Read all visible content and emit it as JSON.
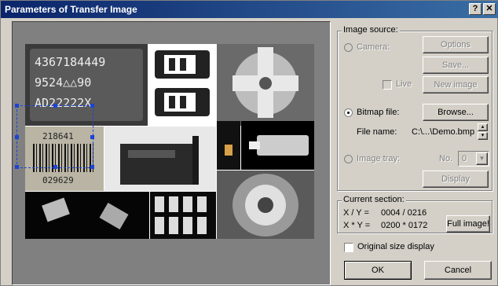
{
  "window": {
    "title": "Parameters of Transfer Image",
    "help_label": "?",
    "close_label": "✕"
  },
  "preview": {
    "barcode_top": "218641",
    "barcode_bottom": "029629",
    "chip_line1": "4367184449",
    "chip_line2": "9524△△90",
    "chip_line3": "AD22222X"
  },
  "image_source": {
    "legend": "Image source:",
    "camera_label": "Camera:",
    "options_label": "Options",
    "save_label": "Save...",
    "live_label": "Live",
    "new_image_label": "New image",
    "bitmap_label": "Bitmap file:",
    "browse_label": "Browse...",
    "file_name_label": "File name:",
    "file_name_value": "C:\\...\\Demo.bmp",
    "image_tray_label": "Image tray:",
    "no_label": "No.",
    "no_value": "0",
    "display_label": "Display",
    "selected": "bitmap"
  },
  "current_section": {
    "legend": "Current section:",
    "xy_label": "X / Y =",
    "xy_value": "0004 / 0216",
    "size_label": "X * Y =",
    "size_value": "0200 * 0172",
    "full_image_label": "Full image!"
  },
  "original_size": {
    "label": "Original size display",
    "checked": false
  },
  "ok_label": "OK",
  "cancel_label": "Cancel"
}
